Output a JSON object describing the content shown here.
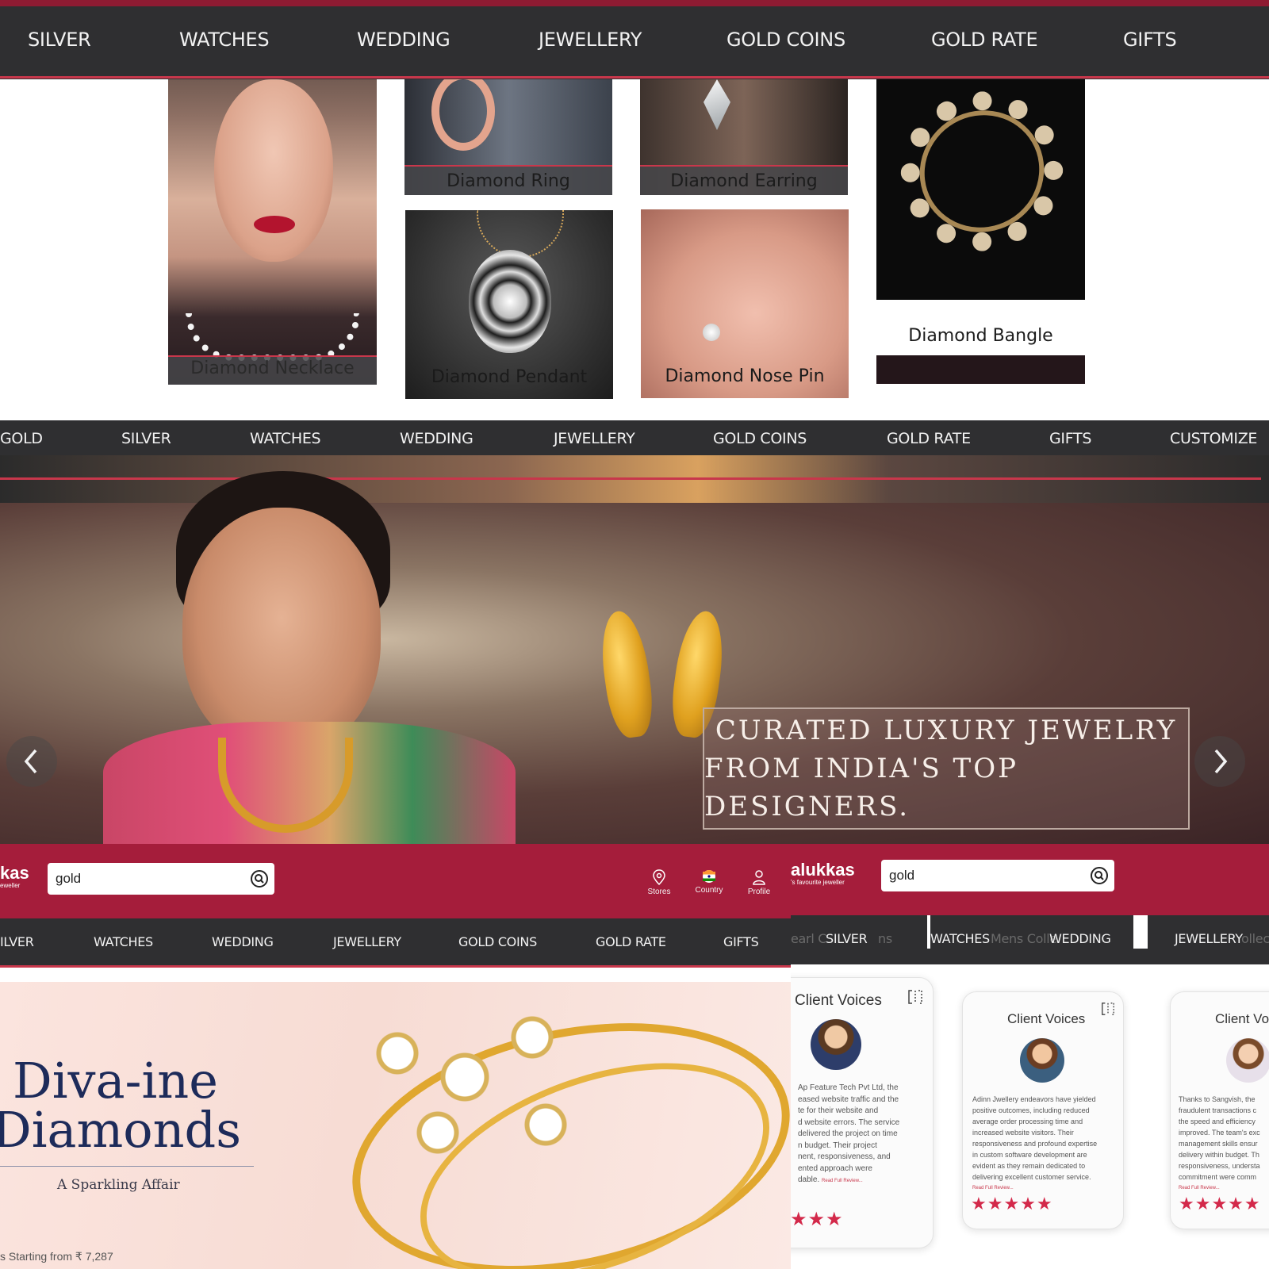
{
  "nav_top": {
    "items": [
      "SILVER",
      "WATCHES",
      "WEDDING",
      "JEWELLERY",
      "GOLD COINS",
      "GOLD RATE",
      "GIFTS"
    ]
  },
  "diamond_tiles": {
    "necklace": "Diamond Necklace",
    "ring": "Diamond Ring",
    "earring": "Diamond Earring",
    "pendant": "Diamond Pendant",
    "nose_pin": "Diamond Nose Pin",
    "bangle": "Diamond Bangle"
  },
  "nav_hero": {
    "items": [
      "GOLD",
      "SILVER",
      "WATCHES",
      "WEDDING",
      "JEWELLERY",
      "GOLD COINS",
      "GOLD RATE",
      "GIFTS",
      "CUSTOMIZE"
    ]
  },
  "hero": {
    "caption_line1": "CURATED LUXURY JEWELRY",
    "caption_line2": "FROM INDIA'S TOP DESIGNERS.",
    "prev_icon": "chevron-left-icon",
    "next_icon": "chevron-right-icon"
  },
  "header_left": {
    "logo_text": "kas",
    "logo_tagline": "eweller",
    "search_value": "gold",
    "util": {
      "stores": "Stores",
      "country": "Country",
      "profile": "Profile"
    }
  },
  "nav_left": {
    "items": [
      "ILVER",
      "WATCHES",
      "WEDDING",
      "JEWELLERY",
      "GOLD COINS",
      "GOLD RATE",
      "GIFTS"
    ]
  },
  "diva_banner": {
    "title_line1": "Diva-ine",
    "title_line2": "Diamonds",
    "subtitle": "A Sparkling Affair",
    "price_text": "s Starting from ₹ 7,287"
  },
  "header_right": {
    "logo_text": "alukkas",
    "logo_tagline": "'s favourite jeweller",
    "search_value": "gold"
  },
  "nav_right": {
    "items": [
      {
        "ghost": "earl C",
        "label": "SILVER",
        "ghost2": "ns"
      },
      {
        "label": "WATCHES",
        "ghost": "Mens Colle"
      },
      {
        "label": "WEDDING"
      },
      {
        "label": "JEWELLERY",
        "ghost": "ollect"
      }
    ]
  },
  "reviews": [
    {
      "title": "Client Voices",
      "lines": [
        "Ap Feature Tech Pvt Ltd, the",
        "eased website traffic and the",
        "te for their website and",
        "d website errors. The service",
        "delivered the project on time",
        "n budget. Their project",
        "nent, responsiveness, and",
        "ented approach were",
        "dable."
      ],
      "link": "Read Full Review...",
      "stars": "★★★"
    },
    {
      "title": "Client Voices",
      "lines": [
        "Adinn Jwellery endeavors have yielded",
        "positive outcomes, including reduced",
        "average order processing time and",
        "increased website visitors. Their",
        "responsiveness and profound expertise",
        "in custom software development are",
        "evident as they remain dedicated to",
        "delivering excellent customer service."
      ],
      "link": "Read Full Review...",
      "stars": "★★★★★"
    },
    {
      "title": "Client Vo",
      "lines": [
        "Thanks to Sangvish, the",
        "fraudulent transactions c",
        "the speed and efficiency",
        "improved. The team's exc",
        "management skills ensur",
        "delivery within budget. Th",
        "responsiveness, understa",
        "commitment were comm"
      ],
      "link": "Read Full Review...",
      "stars": "★★★★★"
    }
  ],
  "colors": {
    "brand_maroon": "#a51d3b",
    "nav_dark": "#2f2f31",
    "accent_red": "#c8374b",
    "star_red": "#d3294a"
  }
}
